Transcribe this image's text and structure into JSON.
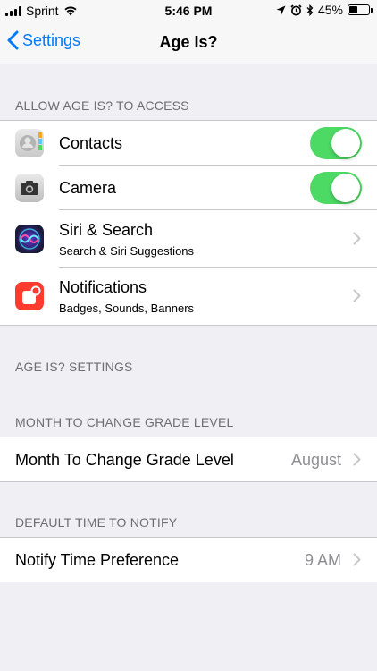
{
  "status_bar": {
    "carrier": "Sprint",
    "time": "5:46 PM",
    "battery_percent": "45%",
    "battery_level": 0.45
  },
  "nav": {
    "back_label": "Settings",
    "title": "Age Is?"
  },
  "access_section": {
    "header": "ALLOW AGE IS? TO ACCESS",
    "items": [
      {
        "label": "Contacts",
        "icon": "contacts-icon",
        "toggle_on": true
      },
      {
        "label": "Camera",
        "icon": "camera-icon",
        "toggle_on": true
      },
      {
        "label": "Siri & Search",
        "subtitle": "Search & Siri Suggestions",
        "icon": "siri-icon"
      },
      {
        "label": "Notifications",
        "subtitle": "Badges, Sounds, Banners",
        "icon": "notifications-icon"
      }
    ]
  },
  "app_settings_header": "AGE IS? SETTINGS",
  "month_section": {
    "header": "MONTH TO CHANGE GRADE LEVEL",
    "label": "Month To Change Grade Level",
    "value": "August"
  },
  "notify_section": {
    "header": "DEFAULT TIME TO NOTIFY",
    "label": "Notify Time Preference",
    "value": "9 AM"
  },
  "colors": {
    "accent": "#007aff",
    "toggle_on": "#4cd964",
    "background": "#efeff4",
    "secondary_text": "#8e8e93"
  }
}
